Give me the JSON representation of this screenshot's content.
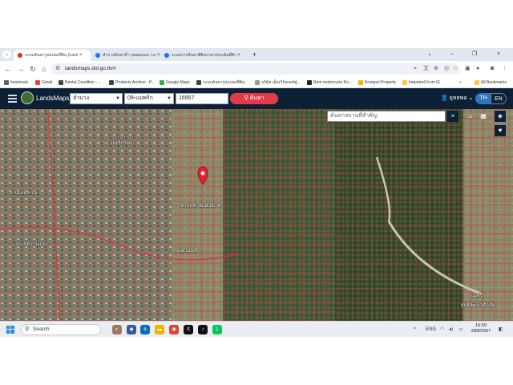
{
  "browser": {
    "tabs": [
      {
        "title": "ระบบค้นหารูปแปลงที่ดิน (LandsMa",
        "active": true,
        "fav_color": "#d93025"
      },
      {
        "title": "ทำการค้นหาที่ • บุคคลแบบ • เอกกากร่",
        "active": false,
        "fav_color": "#1877f2"
      },
      {
        "title": "ระบบการค้นหาที่ดินราคาประเมินที่ดินสหรักษ์",
        "active": false,
        "fav_color": "#1a73e8"
      }
    ],
    "close_glyph": "×",
    "new_tab_glyph": "+",
    "window_controls": [
      "⌄",
      "–",
      "❐",
      "×"
    ],
    "url": "landsmaps.dol.go.th/#",
    "bookmarks": [
      {
        "label": "bookmark",
        "color": "#5f6368"
      },
      {
        "label": "Gmail",
        "color": "#ea4335"
      },
      {
        "label": "Rental Condition - ...",
        "color": "#444444"
      },
      {
        "label": "Products Archive - P...",
        "color": "#444444"
      },
      {
        "label": "Google Maps",
        "color": "#34a853"
      },
      {
        "label": "ระบบค้นหารูปแปลงที่ดิน",
        "color": "#444444"
      },
      {
        "label": "บริษัท เอ็ดเวิร์ดเคฟฟู...",
        "color": "#999999"
      },
      {
        "label": "Rent motorcycle Ro...",
        "color": "#222222"
      },
      {
        "label": "Krungsri Property",
        "color": "#f2b600"
      },
      {
        "label": "Imported From IE",
        "color": "#f9c74f"
      },
      {
        "label": "All Bookmarks",
        "color": "#f9c74f"
      }
    ],
    "bookmarks_more": "»"
  },
  "app": {
    "name": "LandsMaps",
    "province": "ลำปาง",
    "district": "09-แม่พริก",
    "parcel_number": "16957",
    "search_label": "ค้นหา",
    "user_name": "ยุทธพล",
    "lang_th": "TH",
    "lang_en": "EN",
    "place_search_placeholder": "ค้นหาสถานที่สำคัญ"
  },
  "map": {
    "labels": [
      {
        "text": "ร.ร.แม่พริกวิทยา",
        "name": "poi-school"
      },
      {
        "text": "บ้านแม่พริกบน",
        "name": "poi-village"
      },
      {
        "text": "สถานีตำรวจภูธร",
        "name": "poi-police"
      },
      {
        "text": "อบต.แม่พริก",
        "name": "poi-office"
      },
      {
        "text": "ตามหลักแผนผังนิเวศ",
        "name": "poi-parcel-caption"
      },
      {
        "text": "แม่พริก",
        "name": "poi-town"
      },
      {
        "text": "ศูนย์พัฒนาเด็กเล็ก",
        "name": "poi-center"
      }
    ]
  },
  "taskbar": {
    "search_label": "Search",
    "tray_lang": "ENG",
    "time": "16:59",
    "date": "28/8/2567"
  }
}
